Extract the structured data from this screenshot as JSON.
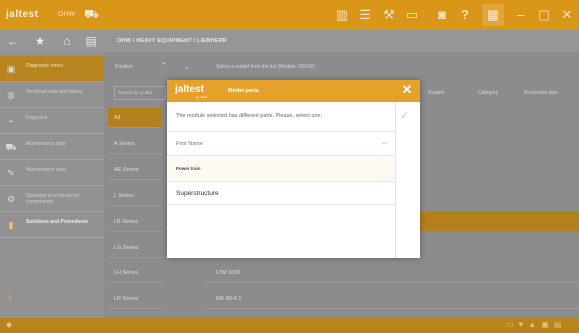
{
  "titlebar": {
    "logo": "jaltest",
    "logo_suffix": "OHW",
    "icons": [
      "truck-icon",
      "signal-icon",
      "list-icon",
      "tools-icon",
      "bars-icon",
      "camera-icon",
      "help-icon",
      "menu-icon",
      "minimize-icon",
      "maximize-icon",
      "close-icon"
    ]
  },
  "navbar": {
    "breadcrumb": "OHW / HEAVY EQUIPMENT / LIEBHERR",
    "icons": [
      "back-arrow-icon",
      "star-icon",
      "home-icon",
      "calendar-icon"
    ]
  },
  "sidebar": {
    "items": [
      {
        "label": "Diagnostic menu",
        "icon": "diagnostic-icon",
        "active": true
      },
      {
        "label": "Technical data and tables",
        "icon": "data-icon"
      },
      {
        "label": "Diagrams",
        "icon": "diagrams-icon"
      },
      {
        "label": "Maintenance data",
        "icon": "maintenance-icon"
      },
      {
        "label": "Maintenance data",
        "icon": "wrench-icon"
      },
      {
        "label": "Standard procedures for components",
        "icon": "procedures-icon"
      },
      {
        "label": "Solutions and Procedures",
        "icon": "book-icon",
        "strong": true
      }
    ],
    "collapse_icon": "chevron-left-icon"
  },
  "content": {
    "filter_label": "Position",
    "filter_hint": "Select a model from the list (Models: 28/156)",
    "search_placeholder": "Search by model",
    "filters": [
      "System",
      "Category",
      "Procedure type"
    ],
    "series": [
      "All",
      "A Series",
      "AE Series",
      "L Series",
      "LB Series",
      "LG Series",
      "LH Series",
      "LR Series"
    ],
    "models": [
      "",
      "",
      "",
      "",
      "",
      "LTM 1000",
      "MK 88-4.1"
    ]
  },
  "modal": {
    "logo": "jaltest",
    "logo_sub": "by cojali",
    "title": "Model parts",
    "close": "✕",
    "message": "The module selected has different parts. Please, select one:",
    "column_header": "First Name",
    "options": [
      "Power train",
      "Superstructure"
    ]
  },
  "colors": {
    "accent": "#e5a12a",
    "titlebar": "#d99619"
  }
}
